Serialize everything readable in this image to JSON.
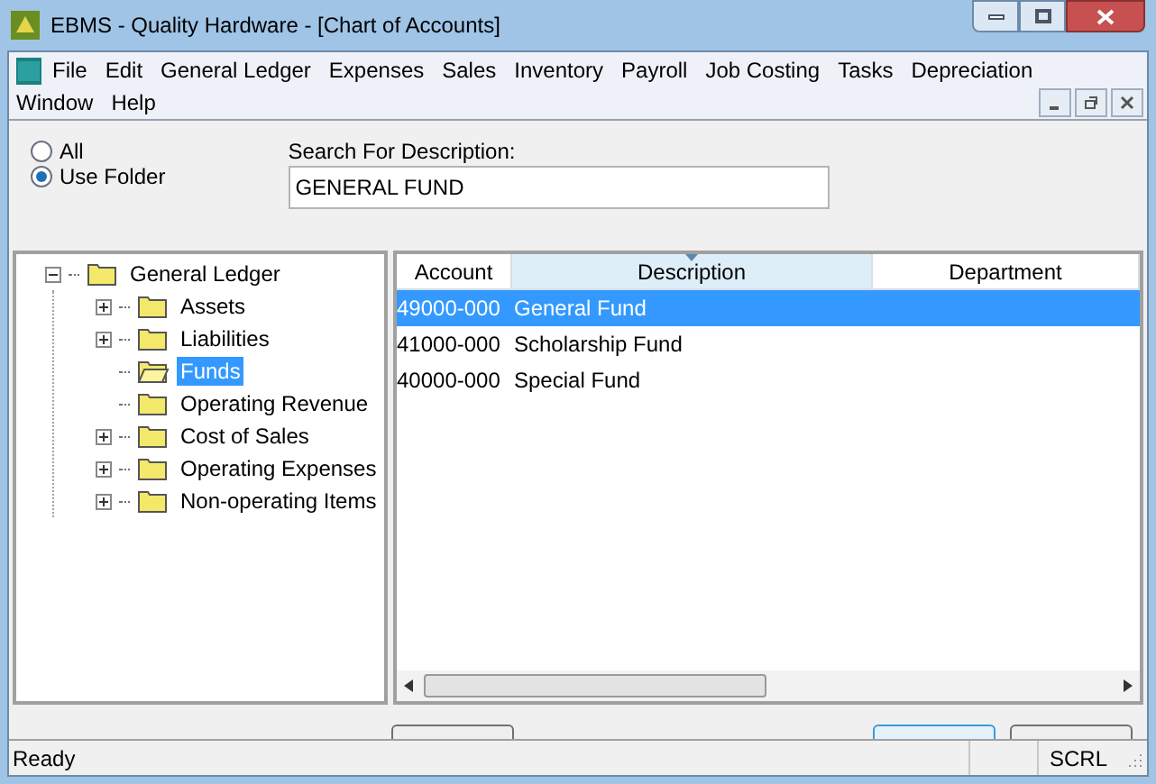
{
  "window": {
    "title": "EBMS - Quality Hardware - [Chart of Accounts]"
  },
  "menu": [
    "File",
    "Edit",
    "General Ledger",
    "Expenses",
    "Sales",
    "Inventory",
    "Payroll",
    "Job Costing",
    "Tasks",
    "Depreciation",
    "Window",
    "Help"
  ],
  "filter": {
    "options": [
      {
        "label": "All",
        "selected": false
      },
      {
        "label": "Use Folder",
        "selected": true
      }
    ],
    "search_label": "Search For Description:",
    "search_value": "GENERAL FUND"
  },
  "tree": [
    {
      "label": "General Ledger",
      "kind": "group",
      "expanded": true,
      "selected": false,
      "children": [
        {
          "label": "Assets",
          "kind": "group",
          "expanded": false,
          "selected": false
        },
        {
          "label": "Liabilities",
          "kind": "group",
          "expanded": false,
          "selected": false
        },
        {
          "label": "Funds",
          "kind": "leaf",
          "selected": true
        },
        {
          "label": "Operating Revenue",
          "kind": "leaf",
          "selected": false
        },
        {
          "label": "Cost of Sales",
          "kind": "group",
          "expanded": false,
          "selected": false
        },
        {
          "label": "Operating Expenses",
          "kind": "group",
          "expanded": false,
          "selected": false
        },
        {
          "label": "Non-operating Items",
          "kind": "group",
          "expanded": false,
          "selected": false
        }
      ]
    }
  ],
  "table": {
    "columns": [
      {
        "label": "Account",
        "sorted": false
      },
      {
        "label": "Description",
        "sorted": true
      },
      {
        "label": "Department",
        "sorted": false
      }
    ],
    "rows": [
      {
        "cells": [
          "49000-000",
          "General Fund"
        ],
        "selected": true
      },
      {
        "cells": [
          "41000-000",
          "Scholarship Fund"
        ],
        "selected": false
      },
      {
        "cells": [
          "40000-000",
          "Special Fund"
        ],
        "selected": false
      }
    ]
  },
  "status_bar": {
    "message": "Ready",
    "indicator": "SCRL"
  }
}
